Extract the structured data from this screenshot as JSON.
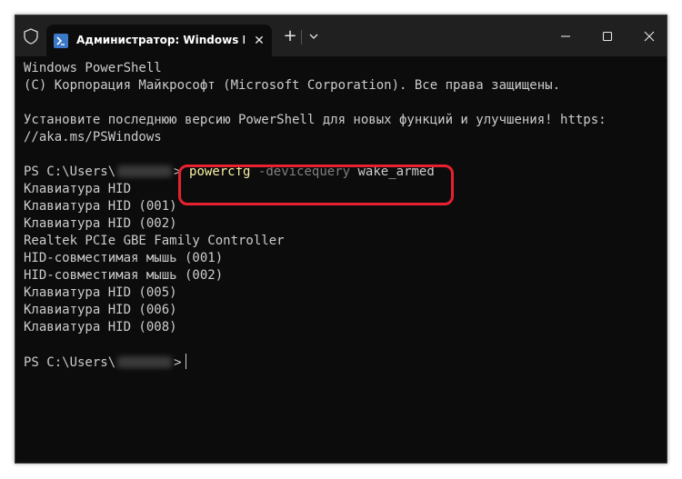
{
  "titlebar": {
    "tab_title": "Администратор: Windows PowerShell",
    "tab_close": "✕",
    "new_tab": "+"
  },
  "console": {
    "header_lines": [
      "Windows PowerShell",
      "(C) Корпорация Майкрософт (Microsoft Corporation). Все права защищены.",
      "",
      "Установите последнюю версию PowerShell для новых функций и улучшения! https:",
      "//aka.ms/PSWindows"
    ],
    "prompt_prefix": "PS C:\\Users\\",
    "prompt_suffix": ">",
    "command": {
      "name": "powercfg",
      "parameter": "-devicequery",
      "argument": "wake_armed"
    },
    "output": [
      "Клавиатура HID",
      "Клавиатура HID (001)",
      "Клавиатура HID (002)",
      "Realtek PCIe GBE Family Controller",
      "HID-совместимая мышь (001)",
      "HID-совместимая мышь (002)",
      "Клавиатура HID (005)",
      "Клавиатура HID (006)",
      "Клавиатура HID (008)"
    ]
  },
  "colors": {
    "background": "#0c0c0c",
    "text": "#cccccc",
    "command": "#f9f1a5",
    "parameter": "#7f7f7f",
    "highlight": "#e8212f"
  },
  "icons": [
    "shield-icon",
    "powershell-icon",
    "close-icon",
    "chevron-down-icon",
    "minimize-icon",
    "maximize-icon",
    "window-close-icon"
  ]
}
